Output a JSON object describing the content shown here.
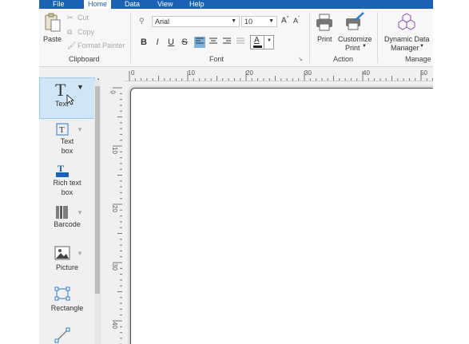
{
  "menu": {
    "file": "File",
    "home": "Home",
    "data": "Data",
    "view": "View",
    "help": "Help"
  },
  "clipboard": {
    "paste": "Paste",
    "cut": "Cut",
    "copy": "Copy",
    "format_painter": "Format Painter",
    "group_label": "Clipboard"
  },
  "font": {
    "family": "Arial",
    "size": "10",
    "group_label": "Font",
    "bold": "B",
    "italic": "I",
    "underline": "U",
    "strike": "S",
    "color_letter": "A"
  },
  "action": {
    "print": "Print",
    "customize": "Customize",
    "customize2": "Print",
    "group_label": "Action"
  },
  "manage": {
    "dynamic": "Dynamic Data",
    "manager": "Manager",
    "group_label": "Manage"
  },
  "tools": {
    "text": "Text",
    "textbox_1": "Text",
    "textbox_2": "box",
    "richtext_1": "Rich text",
    "richtext_2": "box",
    "barcode": "Barcode",
    "picture": "Picture",
    "rectangle": "Rectangle"
  },
  "ruler": {
    "h": [
      "0",
      "10",
      "20",
      "30",
      "40",
      "50"
    ],
    "v": [
      "0",
      "10",
      "20",
      "30",
      "40"
    ]
  },
  "colors": {
    "menubar": "#1b61b4",
    "accent": "#2a7ad1"
  }
}
